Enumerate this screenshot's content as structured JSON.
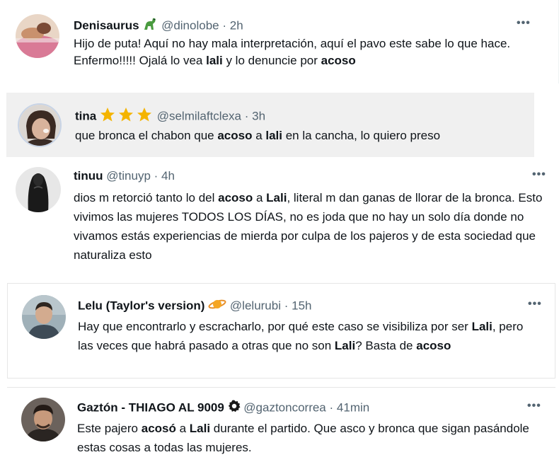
{
  "tweets": [
    {
      "name": "Denisaurus",
      "badge": "dinosaur-emoji",
      "handle": "@dinolobe",
      "time": "2h",
      "more": "•••",
      "text": [
        {
          "t": "Hijo de puta! Aquí no hay mala interpretación, aquí el pavo este sabe lo que hace. Enfermo!!!!! Ojalá lo vea ",
          "b": false
        },
        {
          "t": "lali",
          "b": true
        },
        {
          "t": " y lo denuncie por ",
          "b": false
        },
        {
          "t": "acoso",
          "b": true
        }
      ]
    },
    {
      "name": "tina",
      "badge": "three-star-emoji",
      "handle": "@selmilaftclexa",
      "time": "3h",
      "text": [
        {
          "t": "que bronca el chabon que ",
          "b": false
        },
        {
          "t": "acoso",
          "b": true
        },
        {
          "t": " a ",
          "b": false
        },
        {
          "t": "lali",
          "b": true
        },
        {
          "t": " en la cancha, lo quiero preso",
          "b": false
        }
      ]
    },
    {
      "name": "tinuu",
      "handle": "@tinuyp",
      "time": "4h",
      "more": "•••",
      "text": [
        {
          "t": "dios m retorció tanto lo del ",
          "b": false
        },
        {
          "t": "acoso",
          "b": true
        },
        {
          "t": " a ",
          "b": false
        },
        {
          "t": "Lali",
          "b": true
        },
        {
          "t": ", literal m dan ganas de llorar de la bronca. Esto vivimos las mujeres TODOS LOS DÍAS, no es joda que no hay un solo día donde no vivamos estás experiencias de mierda por culpa de los pajeros y de esta sociedad que naturaliza esto",
          "b": false
        }
      ]
    },
    {
      "name": "Lelu (Taylor's version)",
      "badge": "orange-planet-emoji",
      "handle": "@lelurubi",
      "time": "15h",
      "more": "•••",
      "text": [
        {
          "t": "Hay que encontrarlo y escracharlo, por qué este caso se visibiliza por ser ",
          "b": false
        },
        {
          "t": "Lali",
          "b": true
        },
        {
          "t": ", pero las veces que habrá pasado a otras que no son ",
          "b": false
        },
        {
          "t": "Lali",
          "b": true
        },
        {
          "t": "? Basta de ",
          "b": false
        },
        {
          "t": "acoso",
          "b": true
        }
      ]
    },
    {
      "name": "Gaztón - THIAGO AL 9009",
      "badge": "verified-gear-icon",
      "handle": "@gaztoncorrea",
      "time": "41min",
      "more": "•••",
      "text": [
        {
          "t": "Este pajero ",
          "b": false
        },
        {
          "t": "acosó",
          "b": true
        },
        {
          "t": " a ",
          "b": false
        },
        {
          "t": "Lali",
          "b": true
        },
        {
          "t": " durante el partido. Que asco y bronca que sigan pasándole estas cosas a todas las mujeres.",
          "b": false
        }
      ]
    }
  ],
  "separator": "·"
}
